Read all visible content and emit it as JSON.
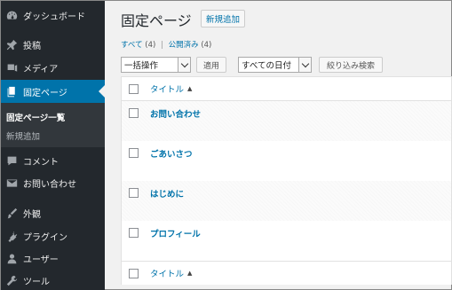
{
  "sidebar": {
    "items": [
      {
        "label": "ダッシュボード",
        "icon": "dashboard-icon"
      },
      {
        "label": "投稿",
        "icon": "pin-icon"
      },
      {
        "label": "メディア",
        "icon": "media-icon"
      },
      {
        "label": "固定ページ",
        "icon": "pages-icon",
        "active": true
      },
      {
        "label": "コメント",
        "icon": "comment-icon"
      },
      {
        "label": "お問い合わせ",
        "icon": "mail-icon"
      },
      {
        "label": "外観",
        "icon": "appearance-icon"
      },
      {
        "label": "プラグイン",
        "icon": "plugin-icon"
      },
      {
        "label": "ユーザー",
        "icon": "user-icon"
      },
      {
        "label": "ツール",
        "icon": "tools-icon"
      }
    ],
    "submenu": [
      {
        "label": "固定ページ一覧",
        "current": true
      },
      {
        "label": "新規追加"
      }
    ]
  },
  "main": {
    "title": "固定ページ",
    "add_new": "新規追加",
    "filters": {
      "all_label": "すべて",
      "all_count": "(4)",
      "separator": "|",
      "published_label": "公開済み",
      "published_count": "(4)"
    },
    "bulk_action": {
      "selected": "一括操作"
    },
    "apply_button": "適用",
    "date_filter": {
      "selected": "すべての日付"
    },
    "filter_button": "絞り込み検索",
    "table": {
      "column_title": "タイトル",
      "sort_glyph": "▲",
      "rows": [
        {
          "title": "お問い合わせ"
        },
        {
          "title": "ごあいさつ"
        },
        {
          "title": "はじめに"
        },
        {
          "title": "プロフィール"
        }
      ]
    }
  }
}
